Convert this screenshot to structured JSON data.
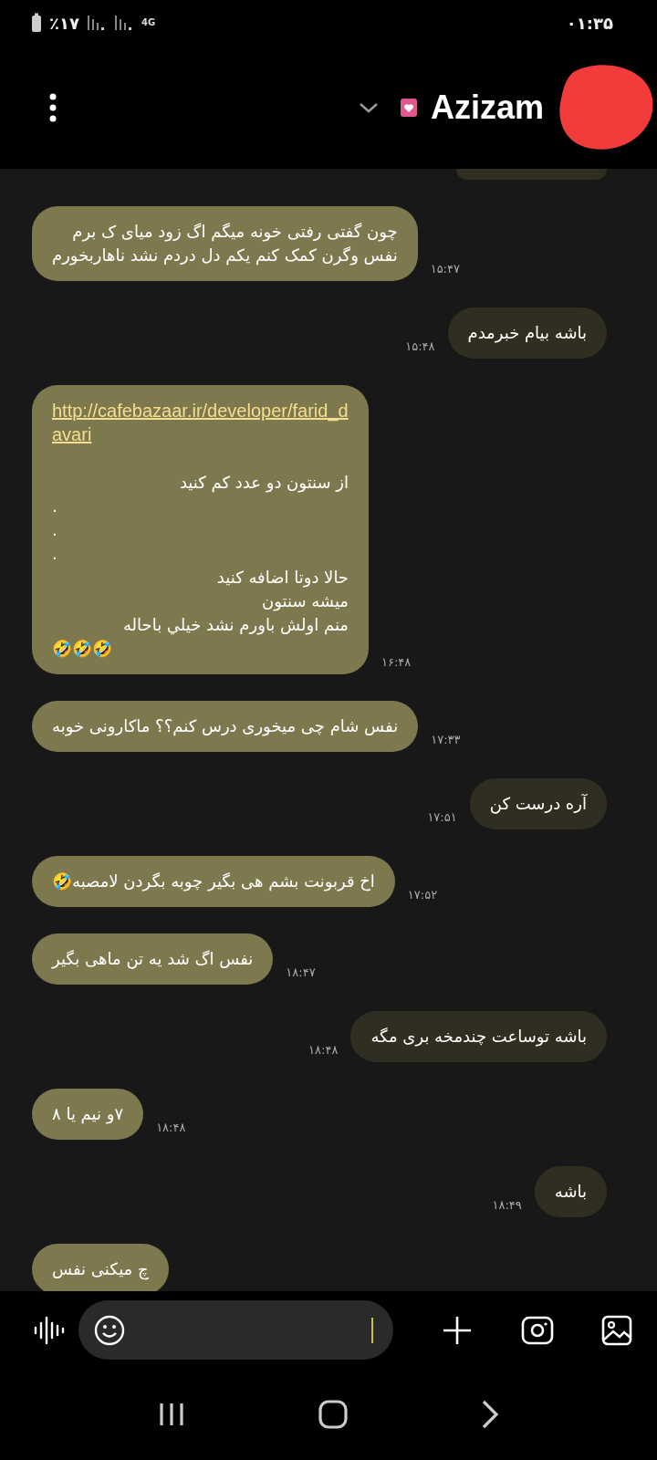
{
  "status_bar": {
    "battery": "٪۱۷",
    "network": "4G",
    "time": "۰۱:۳۵"
  },
  "header": {
    "contact_name": "Azizam"
  },
  "messages": [
    {
      "kind": "received",
      "time": "۱۵:۴۷",
      "lines": [
        {
          "kind": "text",
          "text": "چون گفتی رفتی خونه میگم اگ زود میای ک برم"
        },
        {
          "kind": "text",
          "text": "نفس وگرن کمک کنم یکم دل دردم نشد ناهاربخورم"
        }
      ]
    },
    {
      "kind": "sent",
      "time": "۱۵:۴۸",
      "lines": [
        {
          "kind": "text",
          "text": "باشه بیام خبرمدم"
        }
      ]
    },
    {
      "kind": "received",
      "time": "۱۶:۴۸",
      "lines": [
        {
          "kind": "link",
          "text": "http://cafebazaar.ir/developer/farid_davari"
        },
        {
          "kind": "text",
          "text": "از سنتون دو عدد کم کنید",
          "gap_before": true
        },
        {
          "kind": "text",
          "text": "."
        },
        {
          "kind": "text",
          "text": "."
        },
        {
          "kind": "text",
          "text": "."
        },
        {
          "kind": "text",
          "text": "حالا دوتا اضافه کنید"
        },
        {
          "kind": "text",
          "text": "میشه سنتون"
        },
        {
          "kind": "text",
          "text": "منم اولش باورم نشد خیلي باحاله"
        },
        {
          "kind": "text",
          "text": "🤣🤣🤣"
        }
      ]
    },
    {
      "kind": "received",
      "time": "۱۷:۳۳",
      "lines": [
        {
          "kind": "text",
          "text": "نفس شام چی میخوری درس کنم؟؟ ماکارونی خوبه"
        }
      ]
    },
    {
      "kind": "sent",
      "time": "۱۷:۵۱",
      "lines": [
        {
          "kind": "text",
          "text": "آره درست کن"
        }
      ]
    },
    {
      "kind": "received",
      "time": "۱۷:۵۲",
      "lines": [
        {
          "kind": "text",
          "text": "اخ قربونت بشم هی بگیر چوبه بگردن لامصبه🤣"
        }
      ]
    },
    {
      "kind": "received",
      "time": "۱۸:۴۷",
      "lines": [
        {
          "kind": "text",
          "text": "نفس اگ شد یه تن ماهی بگیر"
        }
      ]
    },
    {
      "kind": "sent",
      "time": "۱۸:۴۸",
      "lines": [
        {
          "kind": "text",
          "text": "باشه توساعت چندمخه بری مگه"
        }
      ]
    },
    {
      "kind": "received",
      "time": "۱۸:۴۸",
      "lines": [
        {
          "kind": "text",
          "text": "۷و نیم یا ۸"
        }
      ]
    },
    {
      "kind": "sent",
      "time": "۱۸:۴۹",
      "lines": [
        {
          "kind": "text",
          "text": "باشه"
        }
      ]
    },
    {
      "kind": "received",
      "lines": [
        {
          "kind": "text",
          "text": "چ میکنی نفس"
        }
      ]
    }
  ]
}
